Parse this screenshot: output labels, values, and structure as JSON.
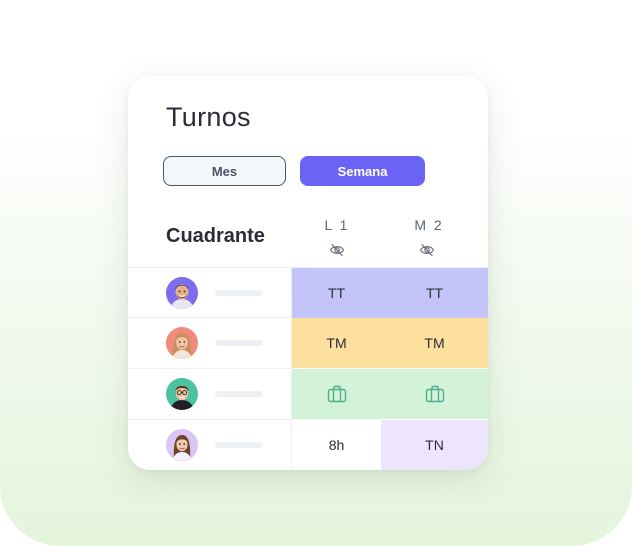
{
  "header": {
    "title": "Turnos"
  },
  "view_toggle": {
    "mes_label": "Mes",
    "semana_label": "Semana",
    "selected": "Semana"
  },
  "grid": {
    "label": "Cuadrante",
    "days": [
      {
        "label": "L 1",
        "icon": "eye-off-icon"
      },
      {
        "label": "M 2",
        "icon": "eye-off-icon"
      }
    ],
    "rows": [
      {
        "avatar": "avatar-man-beard",
        "cells": [
          {
            "text": "TT",
            "color": "#c3c4fa"
          },
          {
            "text": "TT",
            "color": "#c3c4fa"
          }
        ]
      },
      {
        "avatar": "avatar-woman-blonde",
        "cells": [
          {
            "text": "TM",
            "color": "#fde09e"
          },
          {
            "text": "TM",
            "color": "#fde09e"
          }
        ]
      },
      {
        "avatar": "avatar-man-glasses",
        "cells": [
          {
            "icon": "briefcase-icon",
            "color": "#d3f3d8"
          },
          {
            "icon": "briefcase-icon",
            "color": "#d3f3d8"
          }
        ]
      },
      {
        "avatar": "avatar-woman-brunette",
        "cells": [
          {
            "text": "8h",
            "color": "#ffffff"
          },
          {
            "text": "TN",
            "color": "#ede4fe"
          }
        ]
      }
    ]
  },
  "colors": {
    "accent": "#6b63f6",
    "tt": "#c3c4fa",
    "tm": "#fde09e",
    "vacation": "#d3f3d8",
    "tn": "#ede4fe",
    "vacation_icon": "#4fae8e"
  }
}
